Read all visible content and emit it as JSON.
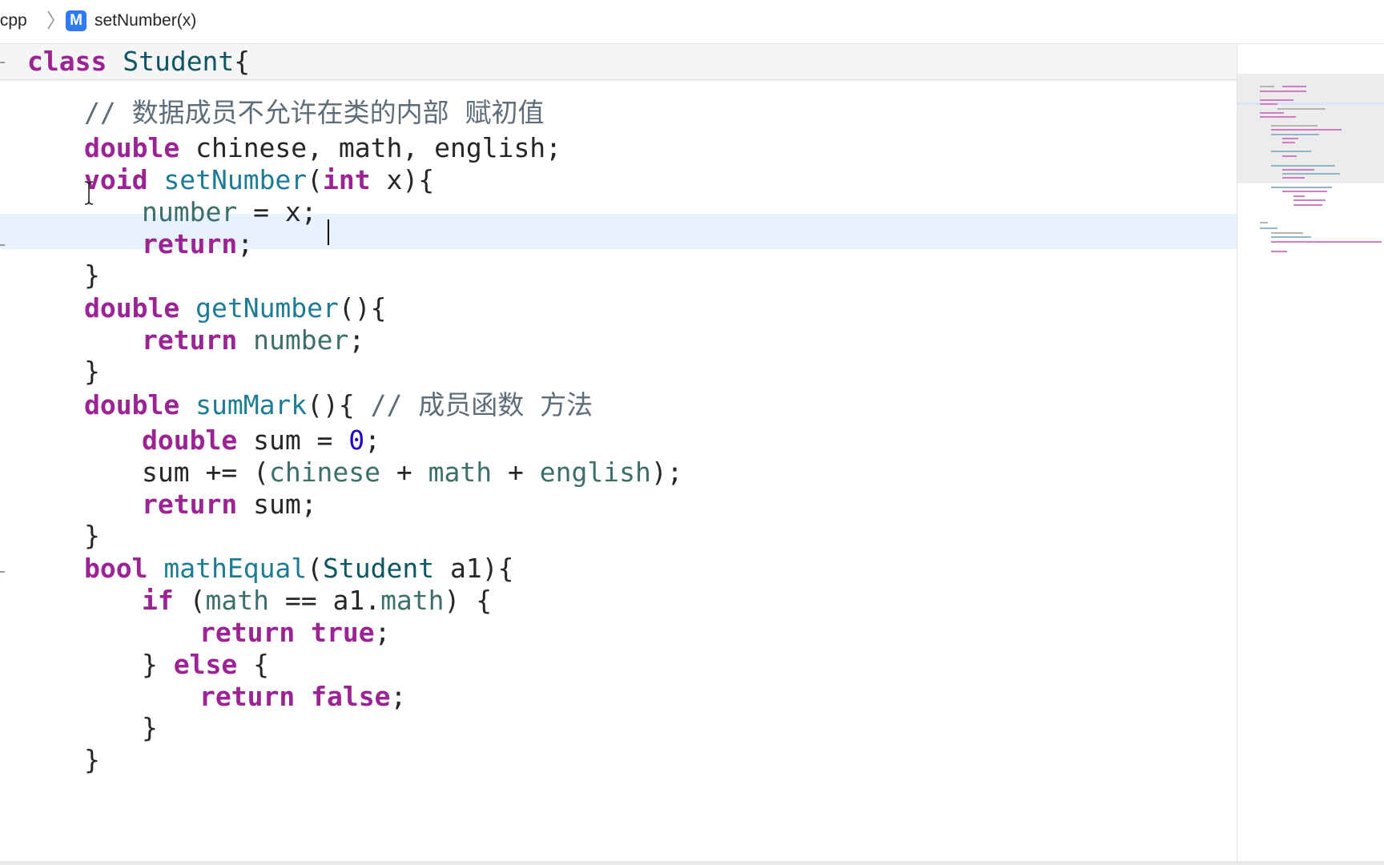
{
  "jump_bar": {
    "file": ".cpp",
    "method_icon": "M",
    "method": "setNumber(x)"
  },
  "editor": {
    "sticky_header": [
      {
        "c": "kw",
        "t": "class"
      },
      {
        "c": "p",
        "t": " "
      },
      {
        "c": "ty",
        "t": "Student"
      },
      {
        "c": "p",
        "t": "{"
      }
    ],
    "lines": [
      [
        {
          "c": "cm",
          "t": "// 数据成员不允许在类的内部 赋初值"
        }
      ],
      [
        {
          "c": "kw",
          "t": "double"
        },
        {
          "c": "p",
          "t": " chinese, math, english;"
        }
      ],
      [
        {
          "c": "kw",
          "t": "void"
        },
        {
          "c": "p",
          "t": " "
        },
        {
          "c": "fn",
          "t": "setNumber"
        },
        {
          "c": "p",
          "t": "("
        },
        {
          "c": "kw",
          "t": "int"
        },
        {
          "c": "p",
          "t": " x){"
        }
      ],
      [
        {
          "c": "pr",
          "t": "number"
        },
        {
          "c": "p",
          "t": " = x;"
        }
      ],
      [
        {
          "c": "kw",
          "t": "return"
        },
        {
          "c": "p",
          "t": ";"
        }
      ],
      [
        {
          "c": "p",
          "t": "}"
        }
      ],
      [
        {
          "c": "kw",
          "t": "double"
        },
        {
          "c": "p",
          "t": " "
        },
        {
          "c": "fn",
          "t": "getNumber"
        },
        {
          "c": "p",
          "t": "(){"
        }
      ],
      [
        {
          "c": "kw",
          "t": "return"
        },
        {
          "c": "p",
          "t": " "
        },
        {
          "c": "pr",
          "t": "number"
        },
        {
          "c": "p",
          "t": ";"
        }
      ],
      [
        {
          "c": "p",
          "t": "}"
        }
      ],
      [
        {
          "c": "kw",
          "t": "double"
        },
        {
          "c": "p",
          "t": " "
        },
        {
          "c": "fn",
          "t": "sumMark"
        },
        {
          "c": "p",
          "t": "(){ "
        },
        {
          "c": "cm",
          "t": "// 成员函数 方法"
        }
      ],
      [
        {
          "c": "kw",
          "t": "double"
        },
        {
          "c": "p",
          "t": " sum = "
        },
        {
          "c": "nm",
          "t": "0"
        },
        {
          "c": "p",
          "t": ";"
        }
      ],
      [
        {
          "c": "p",
          "t": "sum += ("
        },
        {
          "c": "pr",
          "t": "chinese"
        },
        {
          "c": "p",
          "t": " + "
        },
        {
          "c": "pr",
          "t": "math"
        },
        {
          "c": "p",
          "t": " + "
        },
        {
          "c": "pr",
          "t": "english"
        },
        {
          "c": "p",
          "t": ");"
        }
      ],
      [
        {
          "c": "kw",
          "t": "return"
        },
        {
          "c": "p",
          "t": " sum;"
        }
      ],
      [
        {
          "c": "p",
          "t": "}"
        }
      ],
      [
        {
          "c": "kw",
          "t": "bool"
        },
        {
          "c": "p",
          "t": " "
        },
        {
          "c": "fn",
          "t": "mathEqual"
        },
        {
          "c": "p",
          "t": "("
        },
        {
          "c": "ty",
          "t": "Student"
        },
        {
          "c": "p",
          "t": " a1){"
        }
      ],
      [
        {
          "c": "kw",
          "t": "if"
        },
        {
          "c": "p",
          "t": " ("
        },
        {
          "c": "pr",
          "t": "math"
        },
        {
          "c": "p",
          "t": " == a1."
        },
        {
          "c": "pr",
          "t": "math"
        },
        {
          "c": "p",
          "t": ") {"
        }
      ],
      [
        {
          "c": "kw",
          "t": "return"
        },
        {
          "c": "p",
          "t": " "
        },
        {
          "c": "kw",
          "t": "true"
        },
        {
          "c": "p",
          "t": ";"
        }
      ],
      [
        {
          "c": "p",
          "t": "} "
        },
        {
          "c": "kw",
          "t": "else"
        },
        {
          "c": "p",
          "t": " {"
        }
      ],
      [
        {
          "c": "kw",
          "t": "return"
        },
        {
          "c": "p",
          "t": " "
        },
        {
          "c": "kw",
          "t": "false"
        },
        {
          "c": "p",
          "t": ";"
        }
      ],
      [
        {
          "c": "p",
          "t": "}"
        }
      ],
      [
        {
          "c": "p",
          "t": "}"
        }
      ]
    ]
  },
  "colors": {
    "keyword": "#9b2393",
    "function": "#1e7b94",
    "type": "#0f5663",
    "property": "#3c6e6a",
    "number": "#1c00cf",
    "comment": "#5d6c79",
    "current_line": "#e8f2fe",
    "method_icon_bg": "#2f7bf5"
  },
  "icons": {
    "breadcrumb_separator": "chevron-right-icon",
    "method_symbol": "method-icon",
    "mouse_cursor": "ibeam-cursor-icon"
  }
}
